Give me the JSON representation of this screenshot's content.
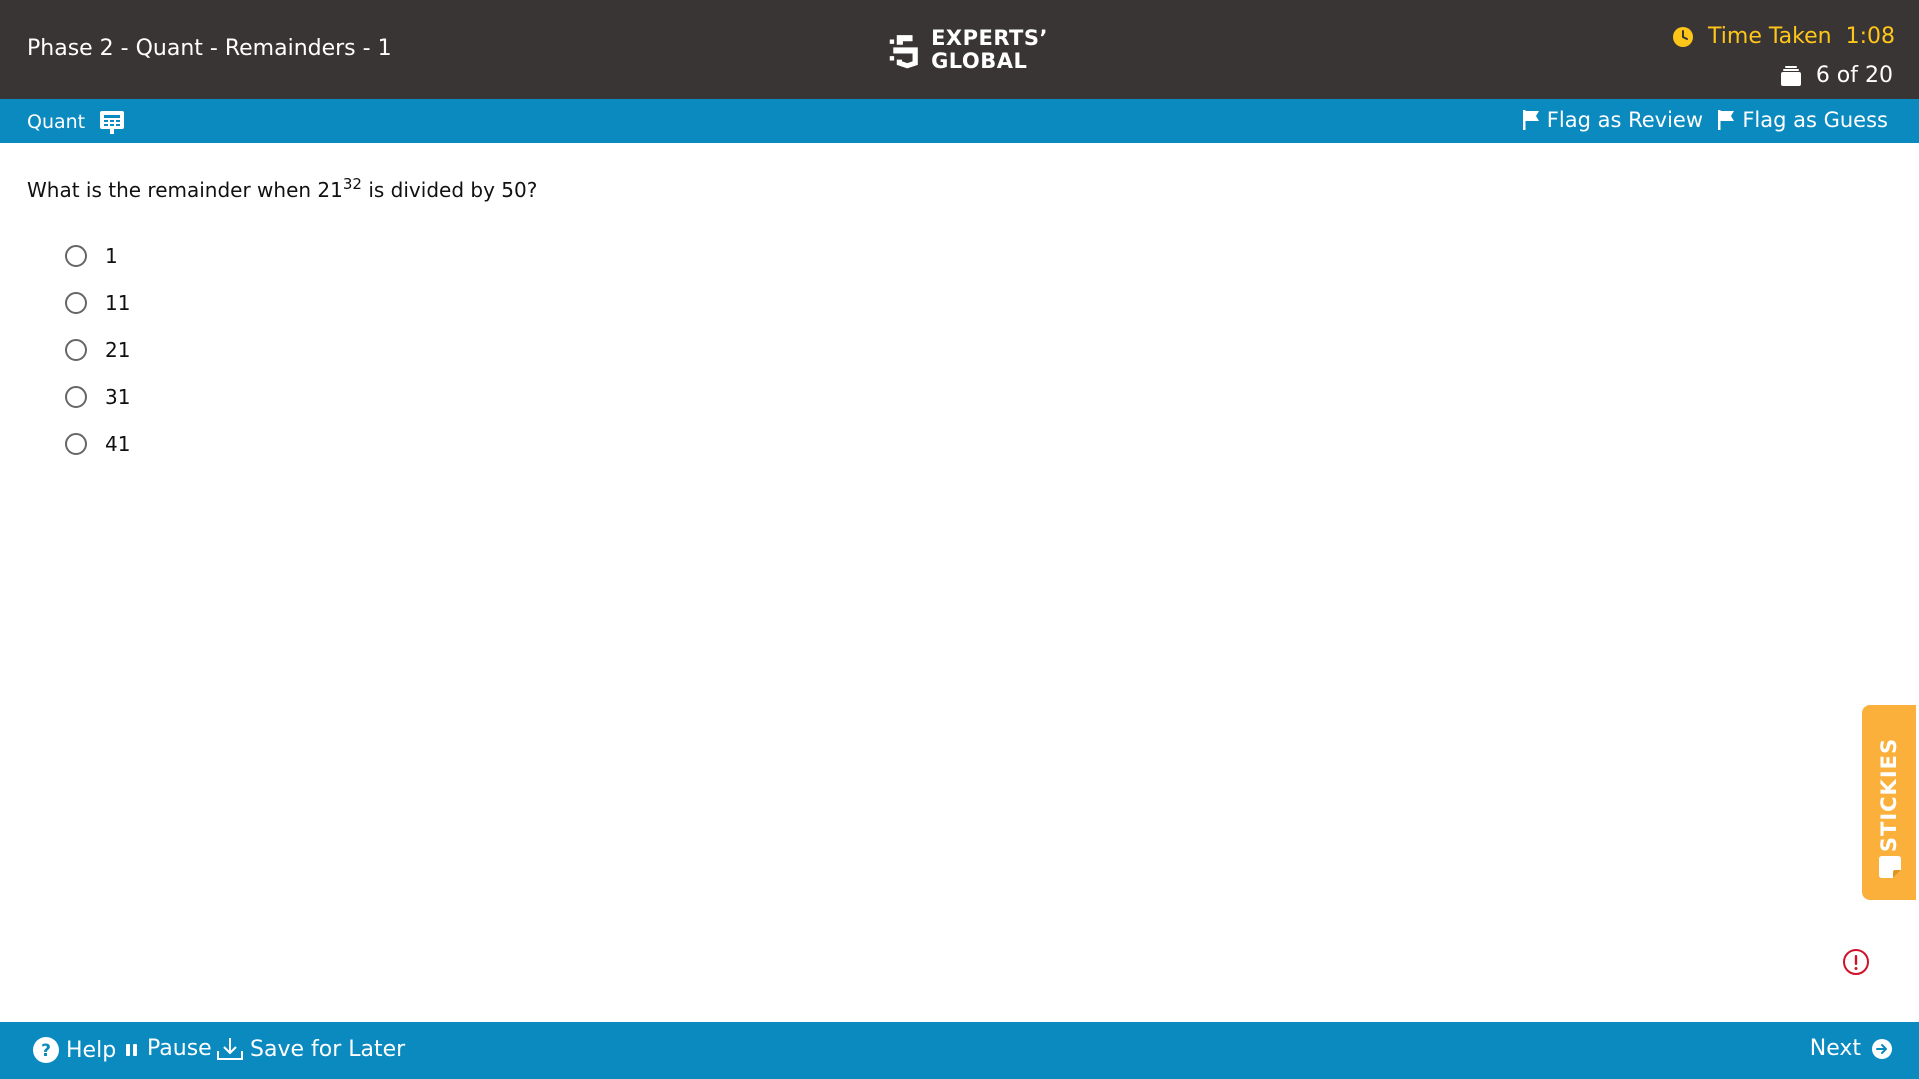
{
  "header": {
    "exam_title": "Phase 2 - Quant - Remainders - 1",
    "logo_line1": "EXPERTS’",
    "logo_line2": "GLOBAL",
    "timer_label": "Time Taken",
    "timer_value": "1:08",
    "progress": "6 of 20",
    "timer_color": "#ffc61a",
    "background_color": "#3a3535"
  },
  "subheader": {
    "section": "Quant",
    "flag_review": "Flag as Review",
    "flag_guess": "Flag as Guess",
    "background_color": "#0b8ac0"
  },
  "question": {
    "text_before": "What is the remainder when 21",
    "exponent": "32",
    "text_after": " is divided by 50?",
    "options": [
      "1",
      "11",
      "21",
      "31",
      "41"
    ],
    "selected": null
  },
  "stickies": {
    "label": "STICKIES",
    "color": "#fbb03b"
  },
  "icons": {
    "clock": "clock-icon",
    "progress": "stack-icon",
    "section": "calculator-icon",
    "flag": "flag-icon",
    "help": "help-icon",
    "pause": "pause-icon",
    "save": "download-icon",
    "next": "arrow-right-circle-icon",
    "alert": "alert-icon",
    "note": "sticky-note-icon"
  },
  "footer": {
    "help": "Help",
    "pause": "Pause",
    "save": "Save for Later",
    "next": "Next"
  }
}
